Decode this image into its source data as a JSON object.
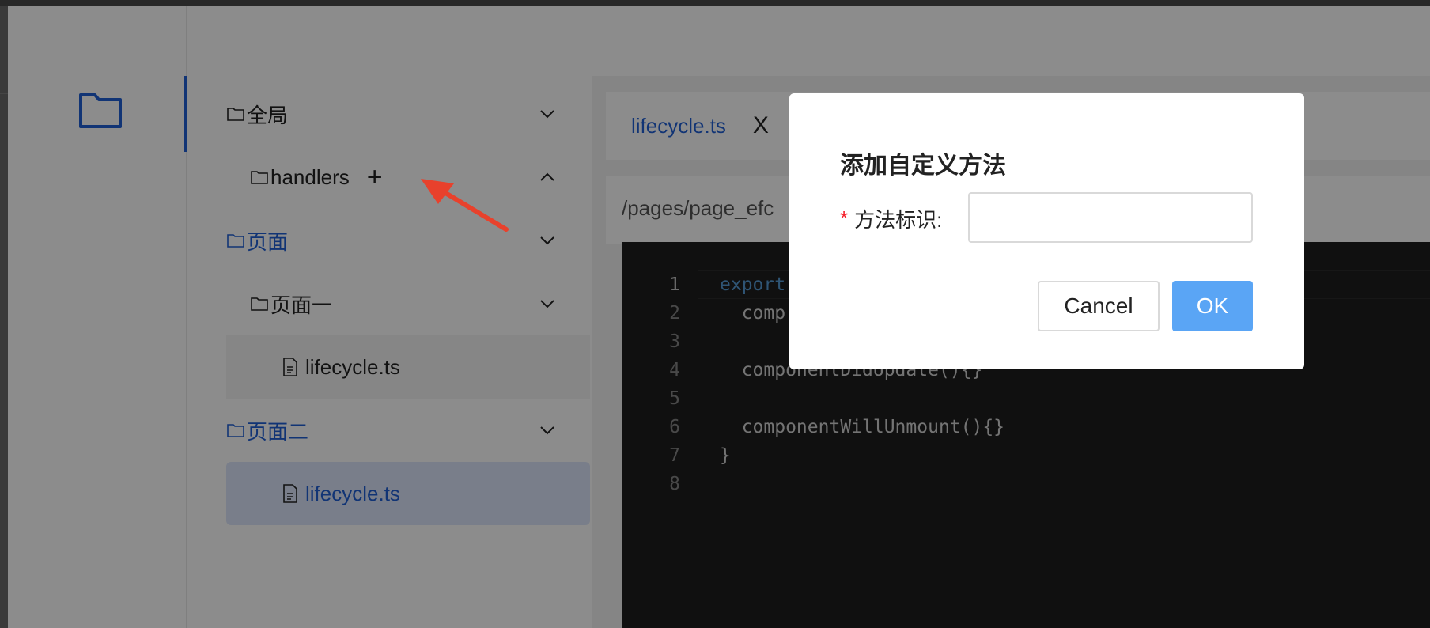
{
  "sidebar": {
    "icon": "folder-icon"
  },
  "tree": {
    "items": [
      {
        "label": "全局",
        "icon": "folder-icon",
        "expand_icon": "chevron-down-icon"
      },
      {
        "label": "handlers",
        "icon": "folder-icon",
        "action_icon": "plus-icon",
        "expand_icon": "chevron-up-icon"
      },
      {
        "label": "页面",
        "icon": "folder-icon",
        "expand_icon": "chevron-down-icon"
      },
      {
        "label": "页面一",
        "icon": "folder-icon",
        "expand_icon": "chevron-down-icon"
      },
      {
        "label": "lifecycle.ts",
        "icon": "file-icon"
      },
      {
        "label": "页面二",
        "icon": "folder-icon",
        "expand_icon": "chevron-down-icon"
      },
      {
        "label": "lifecycle.ts",
        "icon": "file-icon",
        "selected": true
      }
    ],
    "plus_symbol": "+"
  },
  "editor": {
    "tab": {
      "label": "lifecycle.ts",
      "close_symbol": "X"
    },
    "path": "/pages/page_efc",
    "lines": [
      {
        "num": "1",
        "text": "export"
      },
      {
        "num": "2",
        "text": "  comp"
      },
      {
        "num": "3",
        "text": ""
      },
      {
        "num": "4",
        "text": "  componentDidUpdate(){}"
      },
      {
        "num": "5",
        "text": ""
      },
      {
        "num": "6",
        "text": "  componentWillUnmount(){}"
      },
      {
        "num": "7",
        "text": "}"
      },
      {
        "num": "8",
        "text": ""
      }
    ]
  },
  "dialog": {
    "title": "添加自定义方法",
    "required_mark": "*",
    "field_label": "方法标识:",
    "field_value": "",
    "field_placeholder": "",
    "cancel_label": "Cancel",
    "ok_label": "OK"
  },
  "colors": {
    "accent": "#1f5fd6",
    "ok_button": "#5aa5f5",
    "required": "#f5222d",
    "annotation_arrow": "#e8412c",
    "code_background": "#1e1e1e"
  }
}
